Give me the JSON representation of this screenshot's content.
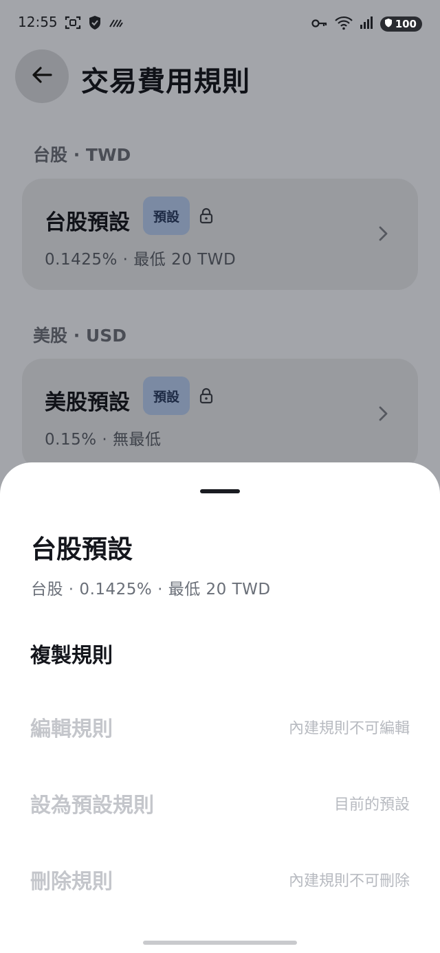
{
  "status_bar": {
    "time": "12:55",
    "battery": "100",
    "icons_left": [
      "screen-capture-icon",
      "shield-icon",
      "data-saver-icon"
    ],
    "icons_right": [
      "vpn-key-icon",
      "wifi-icon",
      "signal-icon",
      "battery-icon"
    ]
  },
  "header": {
    "title": "交易費用規則",
    "back_icon": "arrow-left-icon"
  },
  "sections": [
    {
      "label": "台股 · TWD",
      "rule": {
        "name": "台股預設",
        "badge": "預設",
        "description": "0.1425% · 最低 20 TWD"
      }
    },
    {
      "label": "美股 · USD",
      "rule": {
        "name": "美股預設",
        "badge": "預設",
        "description": "0.15% · 無最低"
      }
    }
  ],
  "sheet": {
    "title": "台股預設",
    "subtitle": "台股 · 0.1425% · 最低 20 TWD",
    "actions": [
      {
        "label": "複製規則",
        "note": "",
        "enabled": true
      },
      {
        "label": "編輯規則",
        "note": "內建規則不可編輯",
        "enabled": false
      },
      {
        "label": "設為預設規則",
        "note": "目前的預設",
        "enabled": false
      },
      {
        "label": "刪除規則",
        "note": "內建規則不可刪除",
        "enabled": false
      }
    ]
  },
  "colors": {
    "overlay_background": "#a3a5aa",
    "card_background": "#999b9f",
    "badge_background": "#7b8aa3",
    "sheet_background": "#ffffff",
    "disabled_text": "#c4c6cb"
  }
}
